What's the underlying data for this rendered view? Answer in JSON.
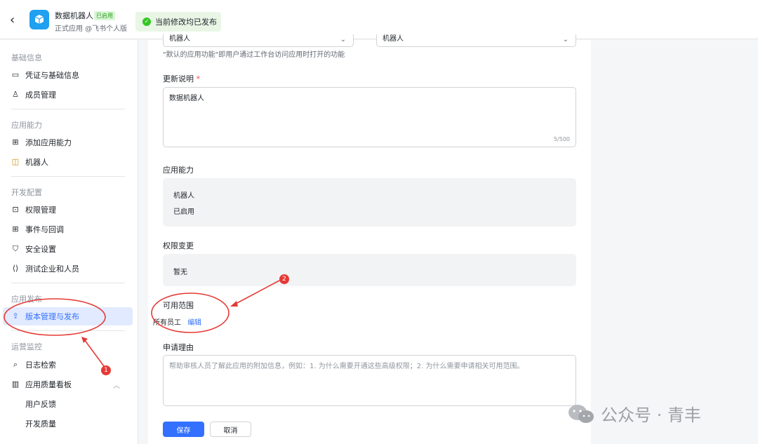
{
  "header": {
    "app_name": "数据机器人",
    "app_status": "已启用",
    "app_subtitle": "正式应用 @飞书个人版",
    "publish_status": "当前修改均已发布"
  },
  "sidebar": {
    "groups": [
      {
        "title": "基础信息",
        "items": [
          {
            "label": "凭证与基础信息",
            "icon": "credential-icon"
          },
          {
            "label": "成员管理",
            "icon": "member-icon"
          }
        ]
      },
      {
        "title": "应用能力",
        "items": [
          {
            "label": "添加应用能力",
            "icon": "grid-add-icon"
          },
          {
            "label": "机器人",
            "icon": "robot-icon"
          }
        ]
      },
      {
        "title": "开发配置",
        "items": [
          {
            "label": "权限管理",
            "icon": "lock-icon"
          },
          {
            "label": "事件与回调",
            "icon": "event-icon"
          },
          {
            "label": "安全设置",
            "icon": "shield-icon"
          },
          {
            "label": "测试企业和人员",
            "icon": "code-icon"
          }
        ]
      },
      {
        "title": "应用发布",
        "items": [
          {
            "label": "版本管理与发布",
            "icon": "upload-icon",
            "active": true
          }
        ]
      },
      {
        "title": "运营监控",
        "items": [
          {
            "label": "日志检索",
            "icon": "search-log-icon"
          },
          {
            "label": "应用质量看板",
            "icon": "bar-chart-icon"
          },
          {
            "label": "用户反馈"
          },
          {
            "label": "开发质量"
          }
        ]
      }
    ]
  },
  "form": {
    "select_left": "机器人",
    "select_right": "机器人",
    "default_hint": "\"默认的应用功能\"即用户通过工作台访问应用时打开的功能",
    "update_label": "更新说明",
    "update_required": "*",
    "update_value": "数据机器人",
    "update_counter": "5/500",
    "capability_label": "应用能力",
    "capability_name": "机器人",
    "capability_status": "已启用",
    "permission_label": "权限变更",
    "permission_value": "暂无",
    "scope_label": "可用范围",
    "scope_value": "所有员工",
    "scope_edit": "编辑",
    "reason_label": "申请理由",
    "reason_placeholder": "帮助审核人员了解此应用的附加信息，例如：1. 为什么需要开通这些高级权限；2. 为什么需要申请相关可用范围。",
    "save": "保存",
    "cancel": "取消"
  },
  "annotations": {
    "mark1": "1",
    "mark2": "2"
  },
  "watermark": {
    "text": "公众号 · 青丰"
  },
  "colors": {
    "primary": "#3370ff",
    "annotation": "#e53935",
    "success": "#34c724"
  }
}
